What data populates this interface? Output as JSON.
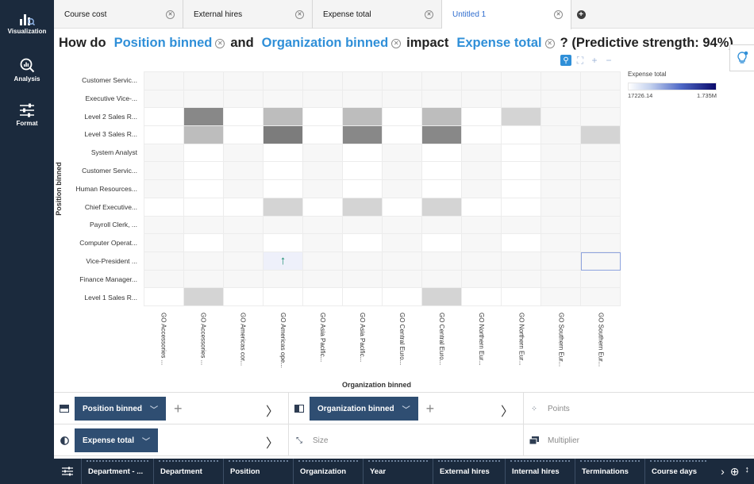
{
  "rail": {
    "items": [
      {
        "label": "Visualization",
        "icon": "visualization-icon"
      },
      {
        "label": "Analysis",
        "icon": "analysis-icon"
      },
      {
        "label": "Format",
        "icon": "format-icon"
      }
    ]
  },
  "tabs": [
    {
      "label": "Course cost",
      "active": false
    },
    {
      "label": "External hires",
      "active": false
    },
    {
      "label": "Expense total",
      "active": false
    },
    {
      "label": "Untitled 1",
      "active": true
    }
  ],
  "question": {
    "prefix": "How do",
    "field1": "Position binned",
    "and": "and",
    "field2": "Organization binned",
    "impact": "impact",
    "field3": "Expense total",
    "suffix": "? (Predictive strength: 94%)"
  },
  "legend": {
    "title": "Expense total",
    "min": "17226.14",
    "max": "1.735M"
  },
  "chart_data": {
    "type": "heatmap",
    "ylabel": "Position binned",
    "xlabel": "Organization binned",
    "rows": [
      "Customer Servic...",
      "Executive Vice-...",
      "Level 2 Sales R...",
      "Level 3 Sales R...",
      "System Analyst",
      "Customer Servic...",
      "Human Resources...",
      "Chief Executive...",
      "Payroll Clerk, ...",
      "Computer Operat...",
      "Vice-President ...",
      "Finance Manager...",
      "Level 1 Sales R..."
    ],
    "columns": [
      "GO Accessories ...",
      "GO Accessories ...",
      "GO Americas cor...",
      "GO Americas ope...",
      "GO Asia Pacific...",
      "GO Asia Pacific...",
      "GO Central Euro...",
      "GO Central Euro...",
      "GO Northern Eur...",
      "GO Northern Eur...",
      "GO Southern Eur...",
      "GO Southern Eur..."
    ],
    "cells": [
      [
        0,
        0,
        0,
        0,
        0,
        0,
        0,
        0,
        0,
        0,
        0,
        0
      ],
      [
        0,
        0,
        0,
        0,
        0,
        0,
        0,
        0,
        0,
        0,
        0,
        0
      ],
      [
        1,
        5,
        1,
        3,
        1,
        3,
        1,
        3,
        1,
        2,
        0,
        0
      ],
      [
        1,
        3,
        1,
        6,
        1,
        5,
        1,
        5,
        1,
        1,
        0,
        2
      ],
      [
        0,
        1,
        0,
        1,
        0,
        1,
        0,
        1,
        0,
        1,
        0,
        0
      ],
      [
        0,
        1,
        0,
        1,
        0,
        1,
        0,
        1,
        0,
        1,
        0,
        0
      ],
      [
        0,
        1,
        0,
        1,
        0,
        1,
        0,
        1,
        0,
        1,
        0,
        0
      ],
      [
        1,
        1,
        1,
        2,
        1,
        2,
        1,
        2,
        1,
        1,
        0,
        0
      ],
      [
        0,
        0,
        0,
        0,
        0,
        0,
        0,
        0,
        0,
        0,
        0,
        0
      ],
      [
        0,
        1,
        0,
        1,
        0,
        1,
        0,
        1,
        0,
        1,
        0,
        0
      ],
      [
        0,
        0,
        0,
        0,
        0,
        0,
        0,
        0,
        0,
        0,
        0,
        0
      ],
      [
        0,
        0,
        0,
        0,
        0,
        0,
        0,
        0,
        0,
        0,
        0,
        0
      ],
      [
        1,
        2,
        1,
        1,
        1,
        1,
        1,
        2,
        1,
        1,
        0,
        0
      ]
    ],
    "highlight": {
      "row": 10,
      "col": 3,
      "marker": "up-arrow-icon"
    },
    "focus_outline": {
      "row": 10,
      "col": 11
    },
    "grid": true,
    "legend_position": "top-right"
  },
  "slots": {
    "rows_slot": {
      "label": "Position binned",
      "icon": "rows-slot-icon"
    },
    "columns_slot": {
      "label": "Organization binned",
      "icon": "columns-slot-icon"
    },
    "color_slot": {
      "label": "Expense total",
      "icon": "color-slot-icon"
    },
    "points": "Points",
    "size": "Size",
    "multiplier": "Multiplier"
  },
  "databar": {
    "items": [
      "Department - ...",
      "Department",
      "Position",
      "Organization",
      "Year",
      "External hires",
      "Internal hires",
      "Terminations",
      "Course days"
    ]
  },
  "colors": {
    "rail_bg": "#1b2a3d",
    "accent_blue": "#2f8fd8",
    "pill_bg": "#2f4e72",
    "arrow_green": "#138a6b"
  }
}
